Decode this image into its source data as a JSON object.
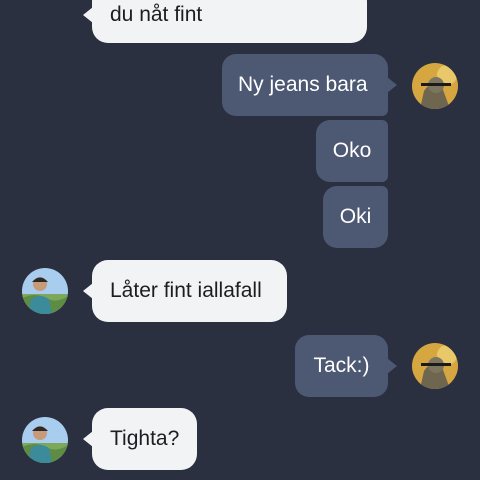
{
  "messages": [
    {
      "sender": "contact",
      "text": "du nåt fint"
    },
    {
      "sender": "me",
      "text": "Ny jeans bara"
    },
    {
      "sender": "me",
      "text": "Oko"
    },
    {
      "sender": "me",
      "text": "Oki"
    },
    {
      "sender": "contact",
      "text": "Låter fint iallafall"
    },
    {
      "sender": "me",
      "text": "Tack:)"
    },
    {
      "sender": "contact",
      "text": "Tighta?"
    }
  ],
  "colors": {
    "background": "#2b3040",
    "incoming_bubble": "#f2f3f5",
    "outgoing_bubble": "#4d5872"
  }
}
